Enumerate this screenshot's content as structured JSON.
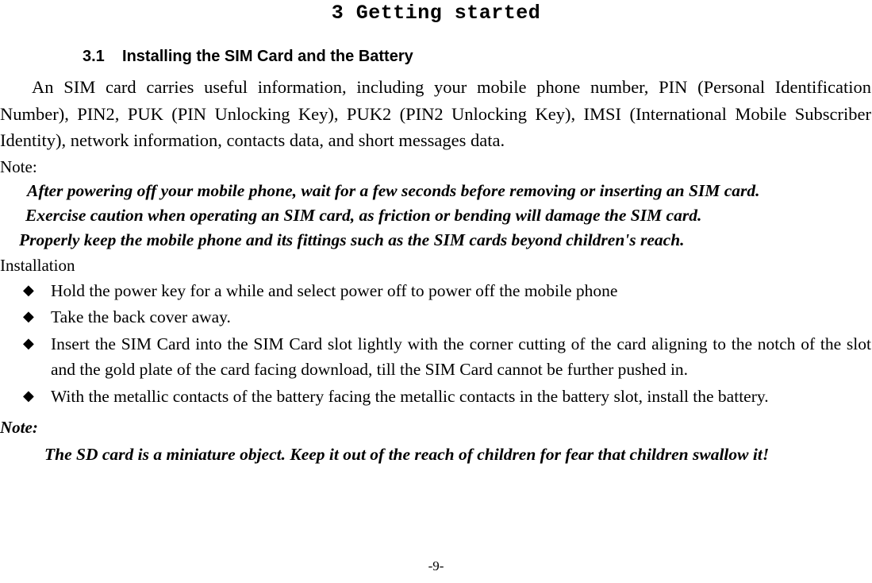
{
  "document": {
    "chapter_title": "3 Getting started",
    "section_heading": "3.1    Installing the SIM Card and the Battery",
    "intro_paragraph": "An SIM card carries useful information, including your mobile phone number, PIN (Personal Identification Number), PIN2, PUK (PIN Unlocking Key), PUK2 (PIN2 Unlocking Key), IMSI (International Mobile Subscriber Identity), network information, contacts data, and short messages data.",
    "note_label": "Note:",
    "notes": [
      "After powering off your mobile phone, wait for a few seconds before removing or inserting an SIM card.",
      "Exercise caution when operating an SIM card, as friction or bending will damage the SIM card.",
      "Properly keep the mobile phone and its fittings such as the SIM cards beyond children's reach."
    ],
    "installation_label": "Installation",
    "bullet_glyph": "◆",
    "installation_steps": [
      "Hold the power key for a while and select power off to power off the mobile phone",
      "Take the back cover away.",
      "Insert the SIM Card into the SIM Card slot lightly with the corner cutting of the card aligning to the notch of the slot and the gold plate of the card facing download, till the SIM Card cannot be further pushed in.",
      "With the metallic contacts of the battery facing the metallic contacts in the battery slot, install the battery."
    ],
    "final_note_label": "Note:",
    "final_note": "The SD card is a miniature object. Keep it out of the reach of children for fear that children swallow it!",
    "page_number": "-9-"
  }
}
